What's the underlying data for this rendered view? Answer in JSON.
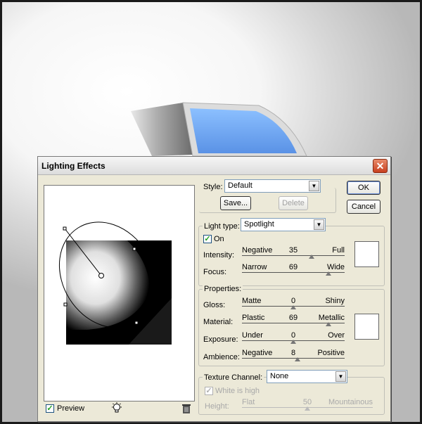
{
  "dialog": {
    "title": "Lighting Effects"
  },
  "preview": {
    "label": "Preview",
    "checked": true
  },
  "style": {
    "label": "Style:",
    "selected": "Default",
    "save_label": "Save...",
    "delete_label": "Delete"
  },
  "buttons": {
    "ok": "OK",
    "cancel": "Cancel"
  },
  "light_type": {
    "label": "Light type:",
    "selected": "Spotlight",
    "on_label": "On",
    "on_checked": true,
    "intensity": {
      "label": "Intensity:",
      "low": "Negative",
      "value": "35",
      "high": "Full",
      "fraction": 0.68
    },
    "focus": {
      "label": "Focus:",
      "low": "Narrow",
      "value": "69",
      "high": "Wide",
      "fraction": 0.84
    }
  },
  "properties": {
    "title": "Properties:",
    "gloss": {
      "label": "Gloss:",
      "low": "Matte",
      "value": "0",
      "high": "Shiny",
      "fraction": 0.5
    },
    "material": {
      "label": "Material:",
      "low": "Plastic",
      "value": "69",
      "high": "Metallic",
      "fraction": 0.84
    },
    "exposure": {
      "label": "Exposure:",
      "low": "Under",
      "value": "0",
      "high": "Over",
      "fraction": 0.5
    },
    "ambience": {
      "label": "Ambience:",
      "low": "Negative",
      "value": "8",
      "high": "Positive",
      "fraction": 0.54
    }
  },
  "texture": {
    "label": "Texture Channel:",
    "selected": "None",
    "white_is_high_label": "White is high",
    "height": {
      "label": "Height:",
      "low": "Flat",
      "value": "50",
      "high": "Mountainous",
      "fraction": 0.5
    }
  },
  "colors": {
    "accent_blue": "#6fa8ec",
    "dialog_bg": "#ece9d8",
    "close_red": "#d2552f"
  }
}
